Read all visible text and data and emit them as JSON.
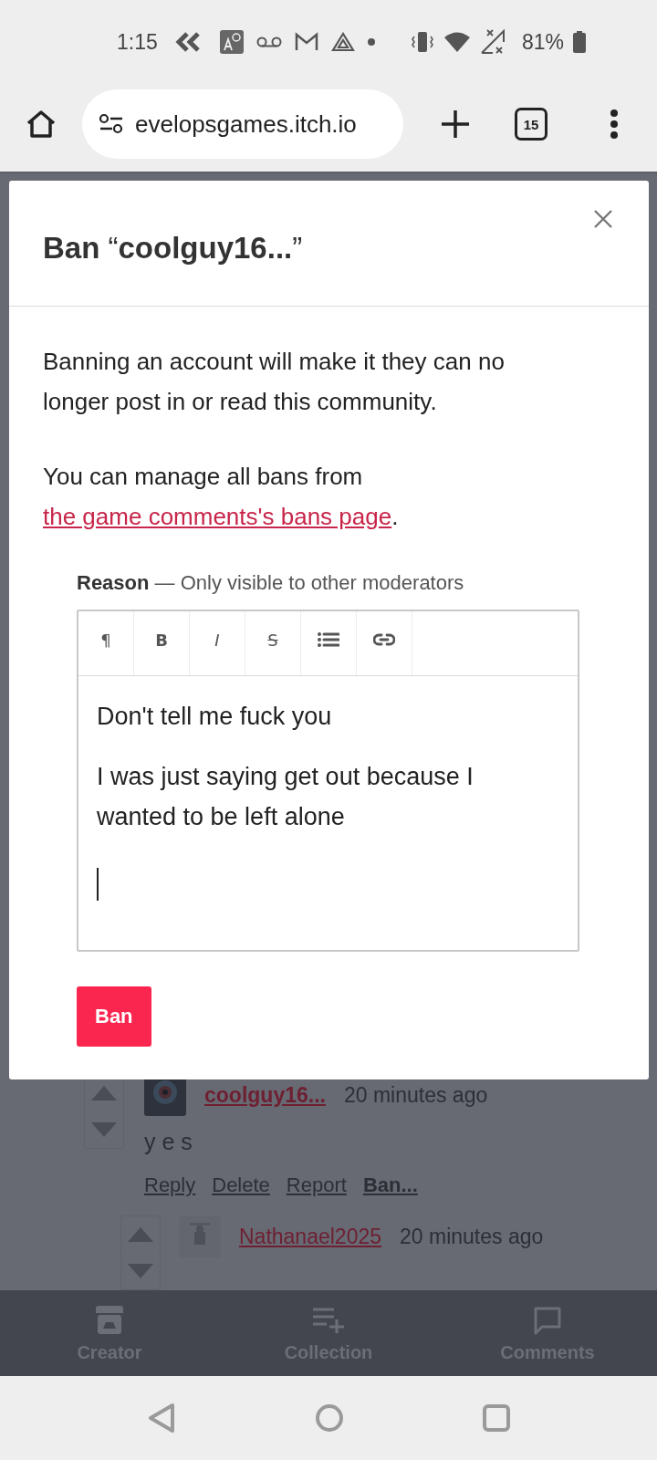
{
  "status_bar": {
    "time": "1:15",
    "battery": "81%"
  },
  "browser": {
    "url": "evelopsgames.itch.io",
    "tab_count": "15"
  },
  "dialog": {
    "title": "**Ban** “**coolguy16...**”",
    "message": "Banning an account will make it they can no longer post in or read this community.",
    "manage_text": "You can manage all bans from ",
    "manage_link": "the game comments's bans page",
    "manage_end": ".",
    "reason_label": "Reason",
    "reason_hint": "— Only visible to other moderators",
    "toolbar": [
      {
        "kind": "paragraph",
        "glyph": "¶"
      },
      {
        "kind": "bold",
        "glyph": "B"
      },
      {
        "kind": "italic",
        "glyph": "I"
      },
      {
        "kind": "strike",
        "glyph": "S"
      },
      {
        "kind": "list"
      },
      {
        "kind": "link"
      }
    ],
    "editor": {
      "focused": true,
      "paragraphs": [
        "Don't tell me fuck you",
        "I was just saying get out because I wanted to be left alone"
      ]
    },
    "button": "Ban"
  },
  "comments": [
    {
      "user": "coolguy16...",
      "time": "20 minutes ago",
      "body": "y e s",
      "actions": [
        {
          "label": "Reply",
          "bold": false
        },
        {
          "label": "Delete",
          "bold": false
        },
        {
          "label": "Report",
          "bold": false
        },
        {
          "label": "Ban...",
          "bold": true
        }
      ]
    },
    {
      "user": "Nathanael2025",
      "time": "20 minutes ago",
      "reply": true
    }
  ],
  "bottom_nav": [
    {
      "kind": "creator",
      "label": "Creator"
    },
    {
      "kind": "collection",
      "label": "Collection"
    },
    {
      "kind": "comments",
      "label": "Comments"
    }
  ]
}
